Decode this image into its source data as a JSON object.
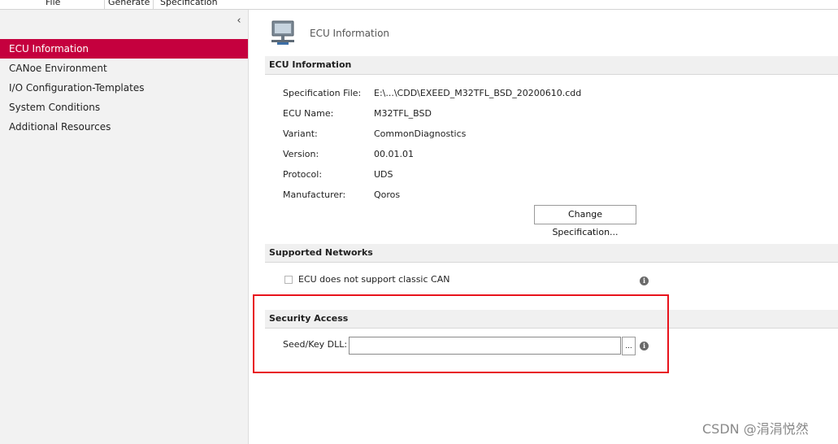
{
  "topbar": {
    "tabs": [
      {
        "label": "File"
      },
      {
        "label": "Generate"
      },
      {
        "label": "Specification"
      }
    ]
  },
  "sidebar": {
    "collapse_glyph": "‹",
    "items": [
      {
        "label": "ECU Information",
        "active": true
      },
      {
        "label": "CANoe Environment"
      },
      {
        "label": "I/O Configuration-Templates"
      },
      {
        "label": "System Conditions"
      },
      {
        "label": "Additional Resources"
      }
    ]
  },
  "main": {
    "header_title": "ECU Information",
    "header_icon": "network-computer-icon",
    "ecu_info": {
      "title": "ECU Information",
      "fields": [
        {
          "label": "Specification File:",
          "value": "E:\\...\\CDD\\EXEED_M32TFL_BSD_20200610.cdd"
        },
        {
          "label": "ECU Name:",
          "value": "M32TFL_BSD"
        },
        {
          "label": "Variant:",
          "value": "CommonDiagnostics"
        },
        {
          "label": "Version:",
          "value": "00.01.01"
        },
        {
          "label": "Protocol:",
          "value": "UDS"
        },
        {
          "label": "Manufacturer:",
          "value": "Qoros"
        }
      ],
      "change_button": "Change Specification..."
    },
    "networks": {
      "title": "Supported Networks",
      "checkbox_label": "ECU does not support classic CAN",
      "checked": false
    },
    "security": {
      "title": "Security Access",
      "seed_label": "Seed/Key DLL:",
      "seed_value": "",
      "browse_label": "..."
    }
  },
  "info_glyph": "i",
  "watermark": "CSDN @涓涓悦然",
  "colors": {
    "active_nav": "#c5003e",
    "highlight_box": "#e8131c"
  }
}
